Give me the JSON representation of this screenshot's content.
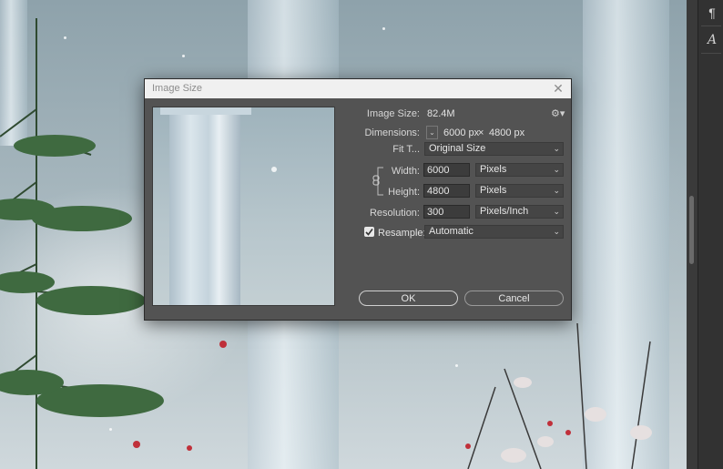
{
  "dialog": {
    "title": "Image Size",
    "image_size_label": "Image Size:",
    "image_size_value": "82.4M",
    "dimensions_label": "Dimensions:",
    "dim_width": "6000 px",
    "dim_x": "×",
    "dim_height": "4800 px",
    "fit_to_label": "Fit T...",
    "fit_to_value": "Original Size",
    "width_label": "Width:",
    "width_value": "6000",
    "width_unit": "Pixels",
    "height_label": "Height:",
    "height_value": "4800",
    "height_unit": "Pixels",
    "resolution_label": "Resolution:",
    "resolution_value": "300",
    "resolution_unit": "Pixels/Inch",
    "resample_label": "Resample:",
    "resample_checked": true,
    "resample_value": "Automatic",
    "ok_label": "OK",
    "cancel_label": "Cancel"
  },
  "icons": {
    "close": "close-icon",
    "gear": "gear-icon",
    "link": "link-icon",
    "paragraph": "paragraph-icon",
    "character": "character-icon"
  },
  "right_panel": {
    "paragraph_glyph": "¶",
    "character_glyph": "A"
  }
}
